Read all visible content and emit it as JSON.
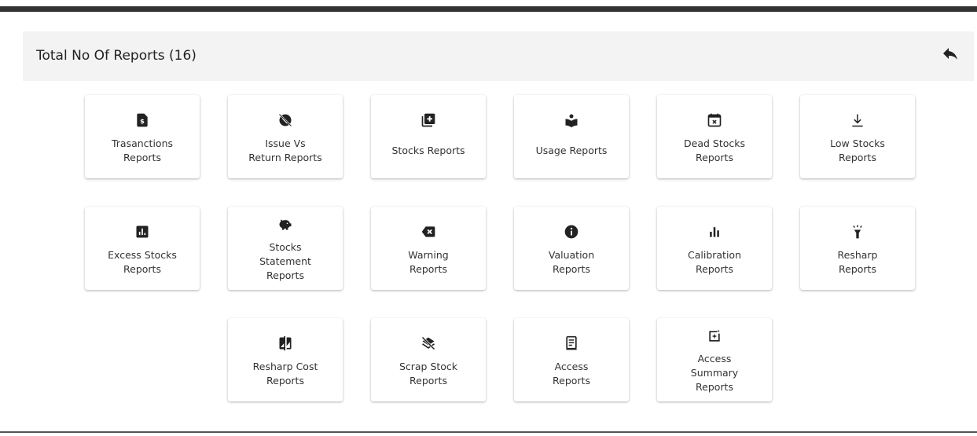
{
  "header": {
    "title": "Total No Of Reports (16)",
    "back_icon": "reply-arrow-icon"
  },
  "reports": [
    {
      "label": "Trasanctions\nReports",
      "icon": "dollar-document-icon"
    },
    {
      "label": "Issue Vs\nReturn Reports",
      "icon": "blocked-tag-icon"
    },
    {
      "label": "Stocks Reports",
      "icon": "library-add-icon"
    },
    {
      "label": "Usage Reports",
      "icon": "open-book-reader-icon"
    },
    {
      "label": "Dead Stocks\nReports",
      "icon": "calendar-remove-icon"
    },
    {
      "label": "Low Stocks\nReports",
      "icon": "arrow-to-bottom-icon"
    },
    {
      "label": "Excess Stocks\nReports",
      "icon": "bar-chart-box-icon"
    },
    {
      "label": "Stocks\nStatement\nReports",
      "icon": "piggy-bank-icon"
    },
    {
      "label": "Warning\nReports",
      "icon": "backspace-icon"
    },
    {
      "label": "Valuation\nReports",
      "icon": "info-circle-icon"
    },
    {
      "label": "Calibration\nReports",
      "icon": "bar-chart-icon"
    },
    {
      "label": "Resharp\nReports",
      "icon": "flashlight-icon"
    },
    {
      "label": "Resharp Cost\nReports",
      "icon": "compare-icon"
    },
    {
      "label": "Scrap Stock\nReports",
      "icon": "layers-off-icon"
    },
    {
      "label": "Access\nReports",
      "icon": "receipt-icon"
    },
    {
      "label": "Access\nSummary\nReports",
      "icon": "sparkle-box-icon"
    }
  ]
}
